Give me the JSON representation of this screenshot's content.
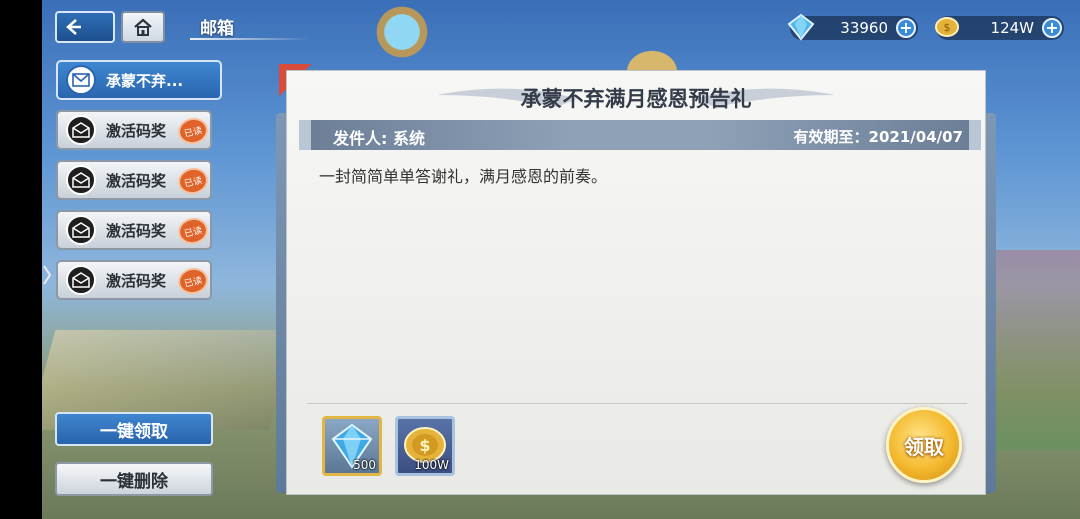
{
  "header": {
    "title": "邮箱",
    "back_icon": "back-arrow-icon",
    "home_icon": "home-icon"
  },
  "resources": {
    "gems": "33960",
    "gold": "124W"
  },
  "mail_list": [
    {
      "label": "承蒙不弃...",
      "state": "selected"
    },
    {
      "label": "激活码奖",
      "state": "read",
      "stamp": "已读"
    },
    {
      "label": "激活码奖",
      "state": "read",
      "stamp": "已读"
    },
    {
      "label": "激活码奖",
      "state": "read",
      "stamp": "已读"
    },
    {
      "label": "激活码奖",
      "state": "read",
      "stamp": "已读"
    }
  ],
  "actions": {
    "claim_all": "一键领取",
    "delete_all": "一键删除"
  },
  "mail": {
    "title": "承蒙不弃满月感恩预告礼",
    "sender": "发件人: 系统",
    "expiry": "有效期至：2021/04/07",
    "body": "一封简简单单答谢礼，满月感恩的前奏。",
    "rewards": [
      {
        "item": "diamond",
        "count": "500"
      },
      {
        "item": "gold-coin",
        "count": "100W"
      }
    ],
    "claim_label": "领取"
  },
  "colors": {
    "accent_blue": "#2a66b0",
    "gold": "#f3b92e",
    "read_stamp": "#e0642a"
  }
}
